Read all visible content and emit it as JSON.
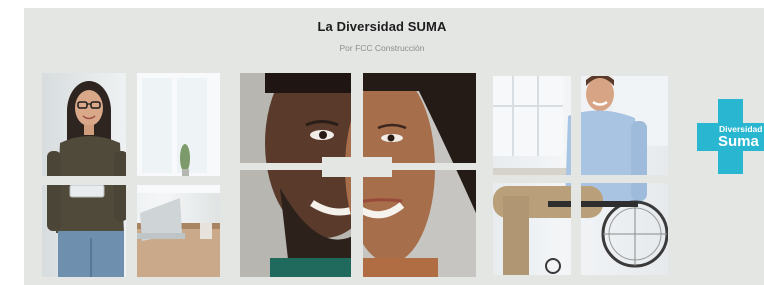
{
  "header": {
    "title": "La Diversidad SUMA",
    "subtitle": "Por FCC Construcción"
  },
  "images": [
    {
      "name": "office-woman-photo",
      "alt": "woman with glasses holding tablet in office"
    },
    {
      "name": "split-faces-photo",
      "alt": "split portrait of smiling man and woman"
    },
    {
      "name": "wheelchair-man-photo",
      "alt": "smiling man in wheelchair in office"
    }
  ],
  "logo": {
    "line1": "Diversidad",
    "line2": "Suma",
    "color": "#29b6d0"
  },
  "colors": {
    "banner_bg": "#e4e6e4",
    "title": "#1d1d1d",
    "subtitle": "#8c8c8c",
    "accent": "#29b6d0"
  }
}
